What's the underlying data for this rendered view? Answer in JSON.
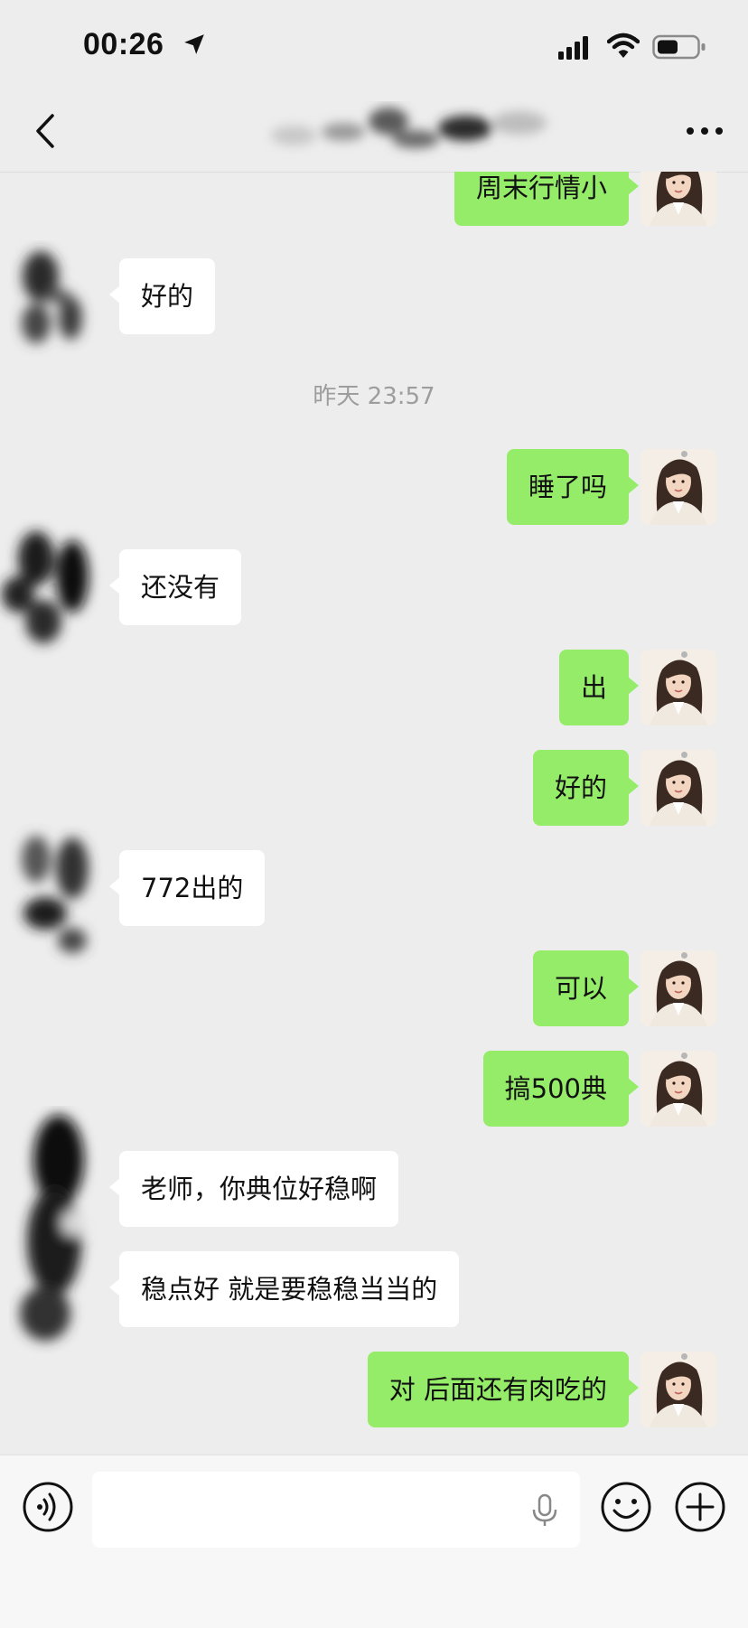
{
  "status_bar": {
    "time": "00:26"
  },
  "nav": {
    "contact_name_blurred": true
  },
  "messages": [
    {
      "side": "out",
      "text": "周末行情小"
    },
    {
      "side": "in",
      "text": "好的"
    },
    {
      "side": "time",
      "text": "昨天 23:57"
    },
    {
      "side": "out",
      "text": "睡了吗"
    },
    {
      "side": "in",
      "text": "还没有"
    },
    {
      "side": "out",
      "text": "出"
    },
    {
      "side": "out",
      "text": "好的"
    },
    {
      "side": "in",
      "text": "772出的"
    },
    {
      "side": "out",
      "text": "可以"
    },
    {
      "side": "out",
      "text": "搞500典"
    },
    {
      "side": "in",
      "text": "老师，你典位好稳啊"
    },
    {
      "side": "in",
      "text": "稳点好 就是要稳稳当当的"
    },
    {
      "side": "out",
      "text": "对 后面还有肉吃的"
    }
  ],
  "colors": {
    "outgoing_bubble": "#95ec69",
    "incoming_bubble": "#ffffff",
    "background": "#ededed"
  },
  "icons": {
    "back": "chevron-left-icon",
    "more": "more-dots-icon",
    "voice": "voice-toggle-icon",
    "mic": "microphone-icon",
    "emoji": "emoji-icon",
    "plus": "plus-icon"
  }
}
